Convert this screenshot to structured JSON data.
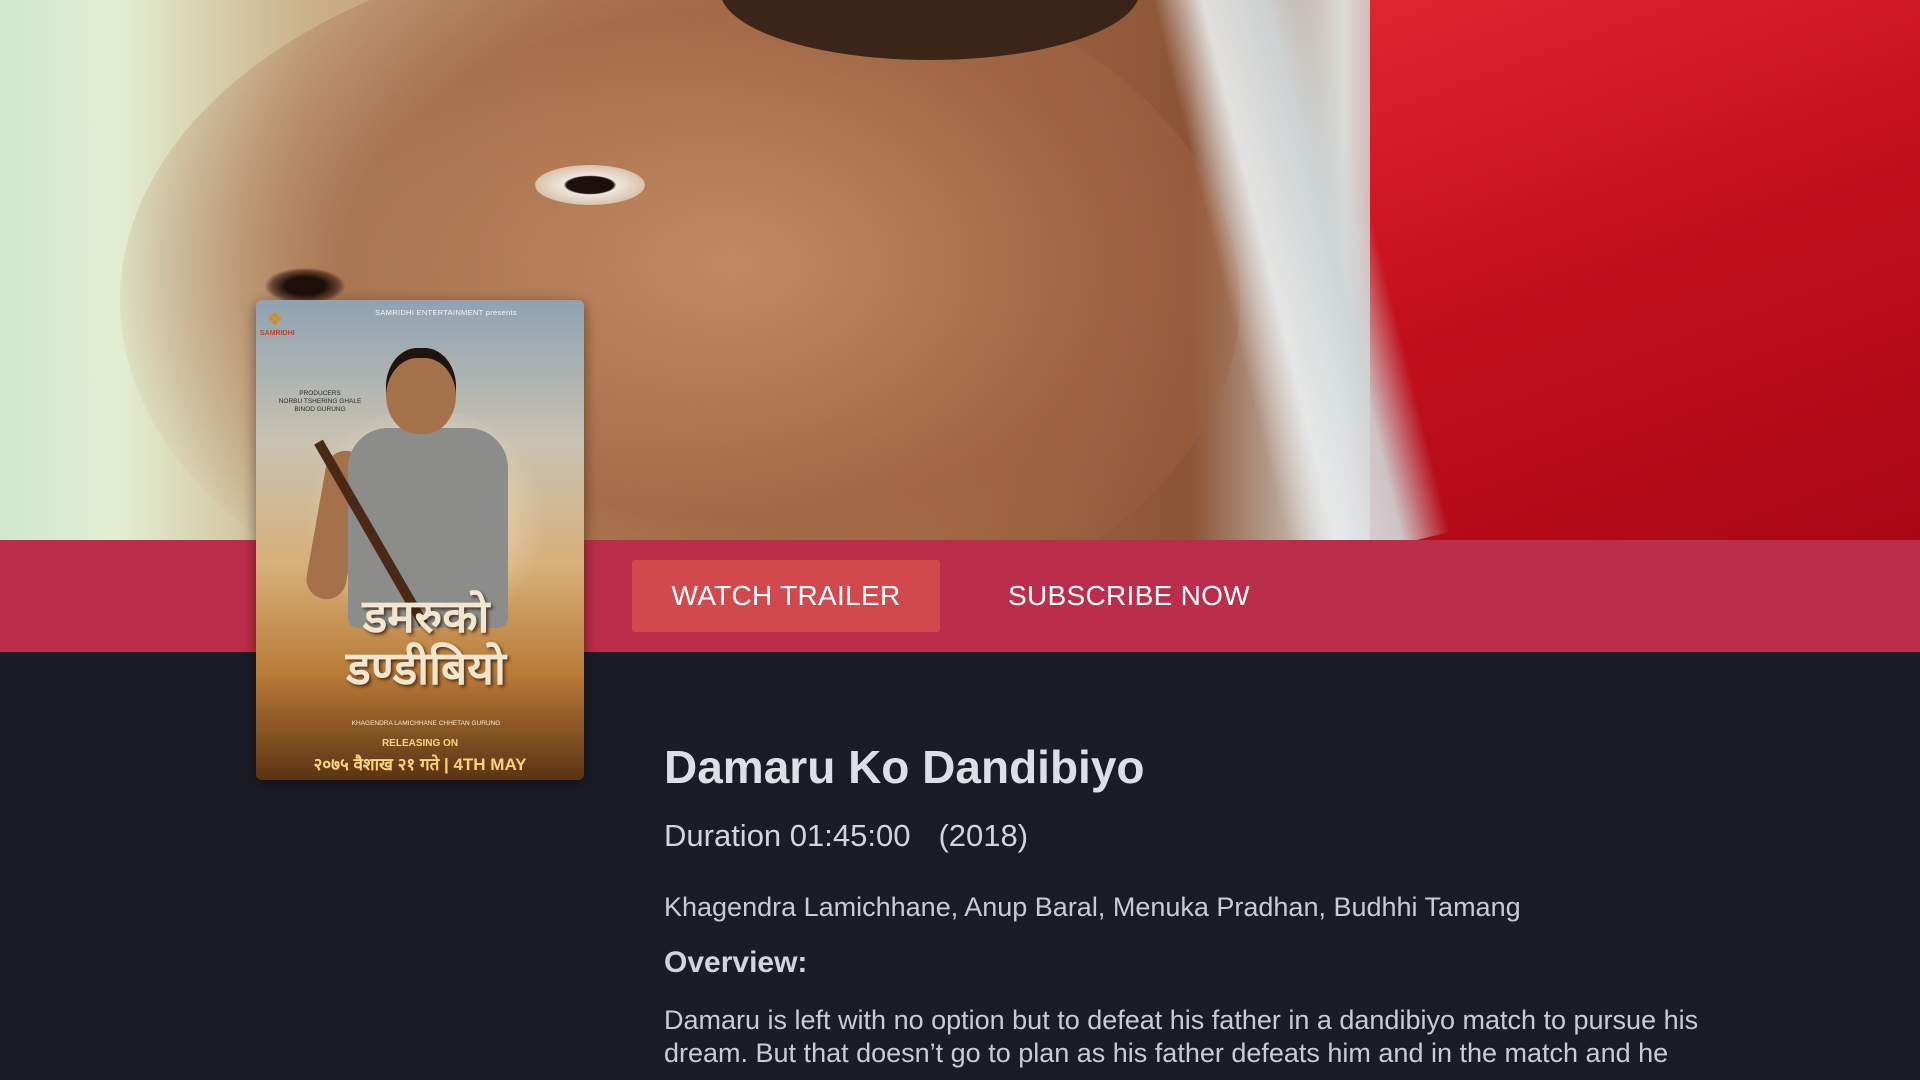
{
  "actions": {
    "watch_trailer": "WATCH TRAILER",
    "subscribe_now": "SUBSCRIBE NOW"
  },
  "poster": {
    "brand": "SAMRIDHI",
    "presents": "SAMRIDHI ENTERTAINMENT presents",
    "producers_label": "PRODUCERS",
    "producers": "NORBU TSHERING GHALE\nBINOD GURUNG",
    "title_devanagari": "डमरुको डण्डीबियो",
    "credits": "KHAGENDRA LAMICHHANE   CHHETAN GURUNG",
    "releasing_on": "RELEASING ON",
    "release_date": "२०७५ वैशाख २१ गते | 4TH MAY"
  },
  "movie": {
    "title": "Damaru Ko Dandibiyo",
    "duration": "Duration 01:45:00",
    "year": "(2018)",
    "cast": "Khagendra Lamichhane, Anup Baral, Menuka Pradhan, Budhhi Tamang",
    "overview_label": "Overview:",
    "overview": "Damaru is left with no option but to defeat his father in a dandibiyo match to pursue his dream. But that doesn’t go to plan as his father defeats him and in the match and he"
  },
  "colors": {
    "action_bar": "#bc2d4b",
    "trailer_button": "#d1484d",
    "background": "#1b1d26"
  },
  "icons": {
    "brand_logo": "samridhi-logo-icon"
  }
}
